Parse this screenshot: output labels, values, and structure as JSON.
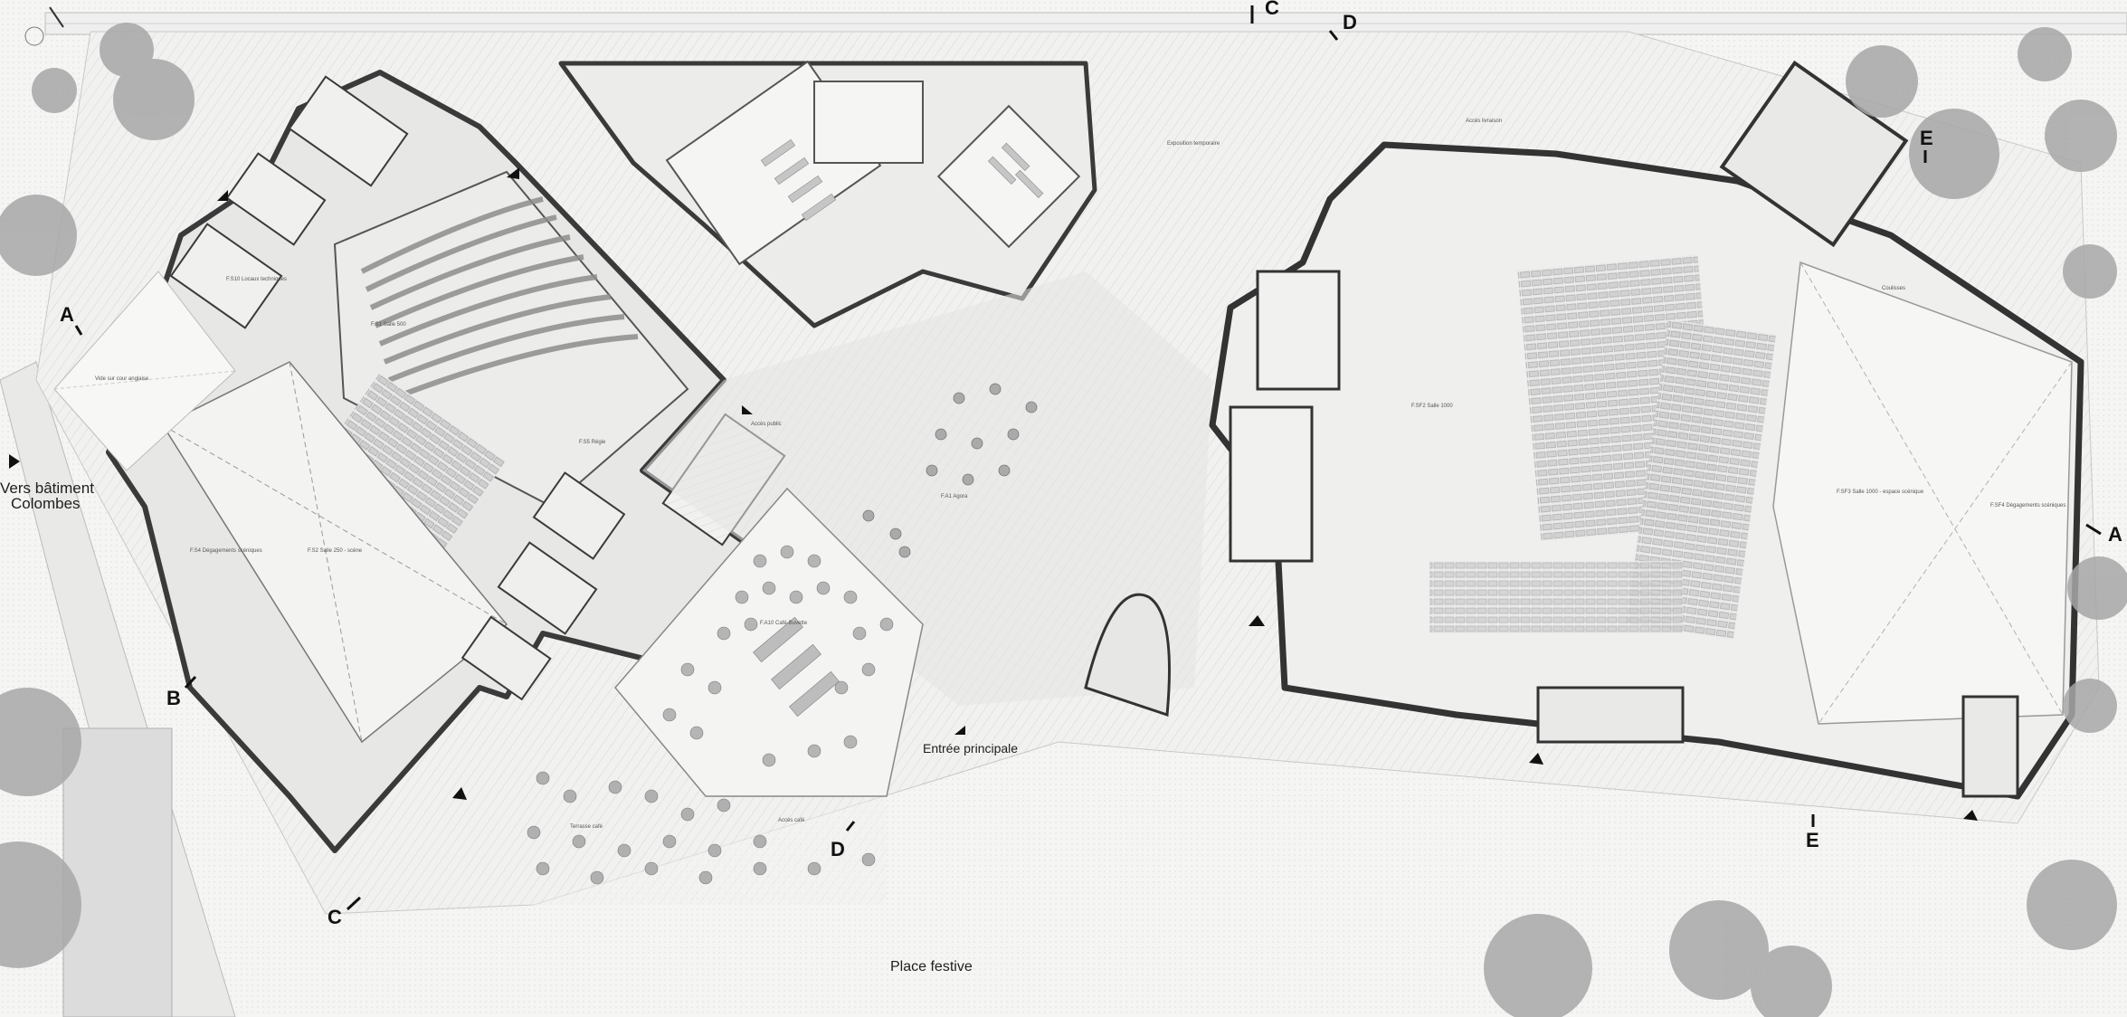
{
  "labels": {
    "vers_batiment": "Vers bâtiment",
    "colombes": "Colombes",
    "entree_principale": "Entrée principale",
    "place_festive": "Place festive"
  },
  "section_marks": {
    "A_left": "A",
    "A_right": "A",
    "B": "B",
    "C_bottom": "C",
    "C_top": "C",
    "D_top": "D",
    "D_bottom": "D",
    "E_top": "E",
    "E_bottom": "E"
  },
  "rooms": {
    "salle_500": "F.S1 Salle 500",
    "salle_250": "F.S2 Salle 250 - scène",
    "salle_1000": "F.SF2 Salle 1000",
    "salle_1000_espace": "F.SF3 Salle 1000 - espace scénique",
    "agora": "F.A1 Agora",
    "cafe": "F.A10 Café-Buvette",
    "terrasse_cafe": "Terrasse café",
    "acces_cafe": "Accès café",
    "exposition_temporaire": "Exposition temporaire",
    "degagements_left": "F.S4 Dégagements scéniques",
    "degagements_right": "F.SF4 Dégagements scéniques",
    "coulisses": "Coulisses",
    "regie": "F.S5 Régie",
    "locaux_tech": "F.S10 Locaux techniques",
    "vide_sur_cour": "Vide sur cour anglaise",
    "acces_public": "Accès public",
    "acces_livraison": "Accès livraison"
  },
  "colors": {
    "background": "#f4f4f3",
    "wall": "#3a3a3a",
    "floor": "#ececeb",
    "hatch": "#d0d0cf",
    "tree": "#a9a9a9"
  }
}
